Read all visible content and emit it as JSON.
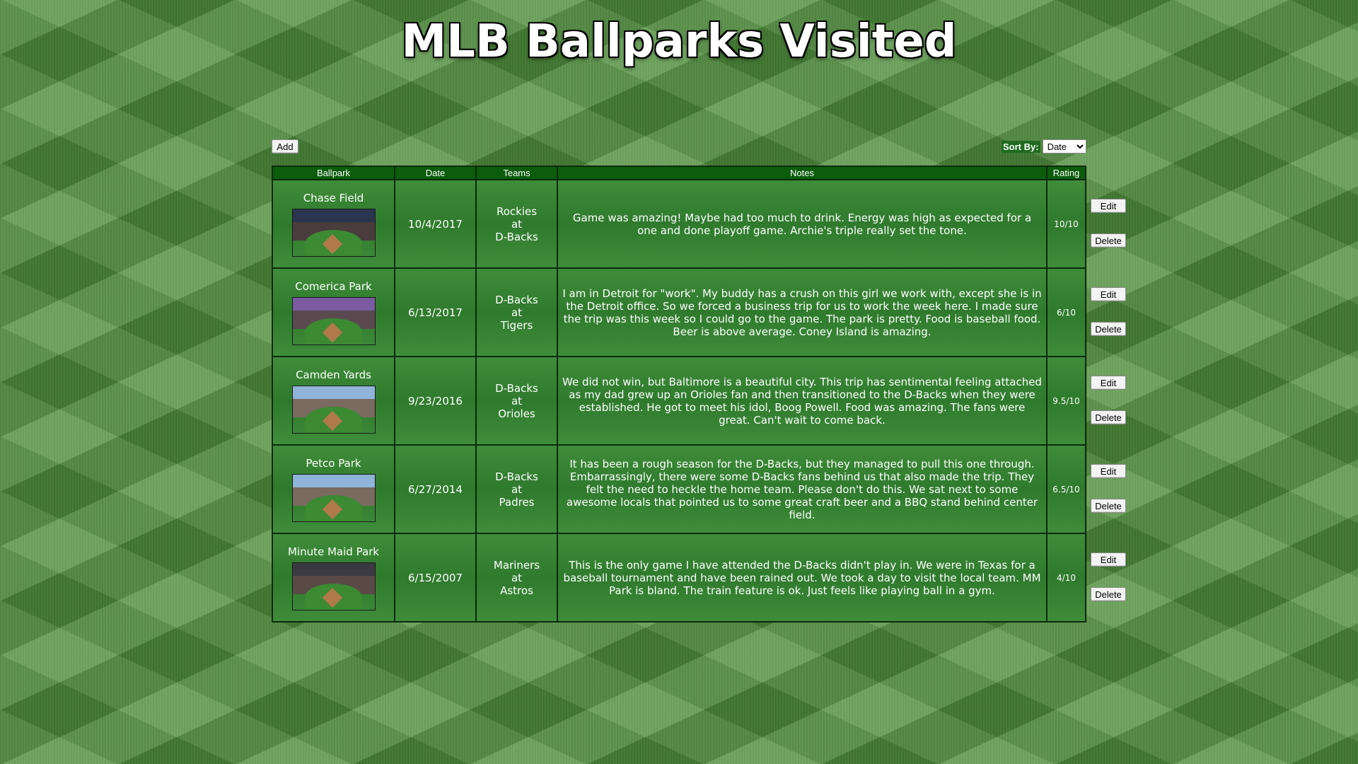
{
  "title": "MLB Ballparks Visited",
  "toolbar": {
    "add_label": "Add",
    "sort_label": "Sort By:",
    "sort_selected": "Date"
  },
  "table": {
    "headers": [
      "Ballpark",
      "Date",
      "Teams",
      "Notes",
      "Rating"
    ],
    "rows": [
      {
        "ballpark": "Chase Field",
        "image": "stadium-photo-dusk",
        "date": "10/4/2017",
        "teams": [
          "Rockies",
          "at",
          "D-Backs"
        ],
        "notes": "Game was amazing! Maybe had too much to drink. Energy was high as expected for a one and done playoff game. Archie's triple really set the tone.",
        "rating": "10/10"
      },
      {
        "ballpark": "Comerica Park",
        "image": "stadium-photo-sunset",
        "date": "6/13/2017",
        "teams": [
          "D-Backs",
          "at",
          "Tigers"
        ],
        "notes": "I am in Detroit for \"work\". My buddy has a crush on this girl we work with, except she is in the Detroit office. So we forced a business trip for us to work the week here. I made sure the trip was this week so I could go to the game. The park is pretty. Food is baseball food. Beer is above average. Coney Island is amazing.",
        "rating": "6/10"
      },
      {
        "ballpark": "Camden Yards",
        "image": "stadium-photo-day",
        "date": "9/23/2016",
        "teams": [
          "D-Backs",
          "at",
          "Orioles"
        ],
        "notes": "We did not win, but Baltimore is a beautiful city. This trip has sentimental feeling attached as my dad grew up an Orioles fan and then transitioned to the D-Backs when they were established. He got to meet his idol, Boog Powell. Food was amazing. The fans were great. Can't wait to come back.",
        "rating": "9.5/10"
      },
      {
        "ballpark": "Petco Park",
        "image": "stadium-photo-day",
        "date": "6/27/2014",
        "teams": [
          "D-Backs",
          "at",
          "Padres"
        ],
        "notes": "It has been a rough season for the D-Backs, but they managed to pull this one through. Embarrassingly, there were some D-Backs fans behind us that also made the trip. They felt the need to heckle the home team. Please don't do this. We sat next to some awesome locals that pointed us to some great craft beer and a BBQ stand behind center field.",
        "rating": "6.5/10"
      },
      {
        "ballpark": "Minute Maid Park",
        "image": "stadium-photo-indoor",
        "date": "6/15/2007",
        "teams": [
          "Mariners",
          "at",
          "Astros"
        ],
        "notes": "This is the only game I have attended the D-Backs didn't play in. We were in Texas for a baseball tournament and have been rained out. We took a day to visit the local team. MM Park is bland. The train feature is ok. Just feels like playing ball in a gym.",
        "rating": "4/10"
      }
    ],
    "edit_label": "Edit",
    "delete_label": "Delete"
  },
  "colors": {
    "grass": "#4f8f3c",
    "cell": "#3f8c3a",
    "header": "#0b5c0b",
    "border": "#0a2a0a",
    "text": "#ffffff"
  }
}
